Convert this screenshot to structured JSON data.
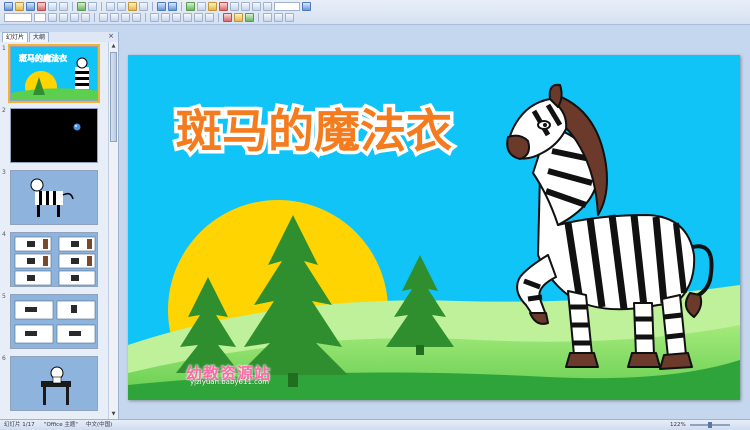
{
  "pane": {
    "tabs": [
      "幻灯片",
      "大纲"
    ],
    "close_glyph": "×",
    "slide_numbers": [
      "1",
      "2",
      "3",
      "4",
      "5",
      "6"
    ]
  },
  "slide": {
    "title": "斑马的魔法衣",
    "watermark_logo": "幼教资源站",
    "watermark_url": "yjziyuan.baby611.com"
  },
  "status": {
    "slide_indicator": "幻灯片 1/17",
    "theme": "\"Office 主题\"",
    "language": "中文(中国)",
    "zoom": "122%"
  },
  "colors": {
    "sky": "#11c4f7",
    "sun": "#ffd400",
    "tree_dark": "#2f8f2f",
    "grass": "#5ccf4f",
    "title_fill": "#f47c1e",
    "zebra_mane": "#6b3a2a"
  },
  "icons": {
    "toolbar": "generic-toolbar-icons",
    "pane_close": "close-icon"
  }
}
